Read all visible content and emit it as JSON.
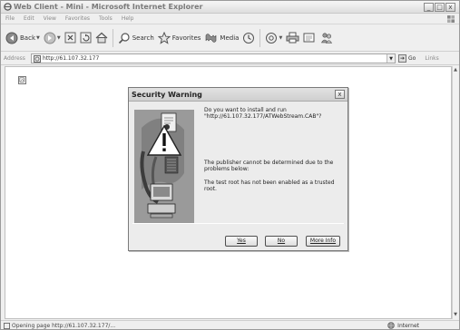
{
  "window": {
    "title": "Web Client - Mini - Microsoft Internet Explorer",
    "controls": [
      "_",
      "□",
      "x"
    ]
  },
  "menu": [
    "File",
    "Edit",
    "View",
    "Favorites",
    "Tools",
    "Help"
  ],
  "toolbar": {
    "back_label": "Back",
    "search_label": "Search",
    "favorites_label": "Favorites",
    "media_label": "Media"
  },
  "address": {
    "label": "Address",
    "url": "http://61.107.32.177",
    "go_label": "Go",
    "links_label": "Links"
  },
  "dialog": {
    "title": "Security Warning",
    "close_glyph": "x",
    "message1": "Do you want to install and run \"http://61.107.32.177/ATWebStream.CAB\"?",
    "message2": "The publisher cannot be determined due to the problems below:",
    "message3": "The test root has not been enabled as a trusted root.",
    "buttons": {
      "yes": "Yes",
      "no": "No",
      "more": "More Info"
    }
  },
  "status": {
    "text": "Opening page http://61.107.32.177/...",
    "zone": "Internet"
  }
}
